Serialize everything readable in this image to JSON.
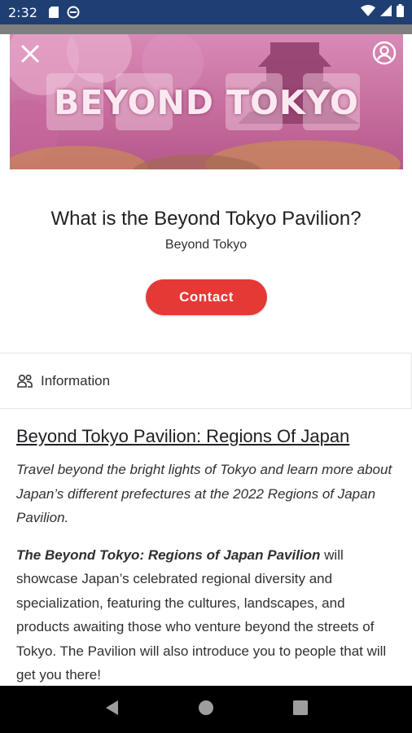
{
  "status_bar": {
    "time": "2:32",
    "icons": [
      "sd-card-icon",
      "do-not-disturb-icon",
      "wifi-icon",
      "signal-icon",
      "battery-icon"
    ]
  },
  "header": {
    "banner_text": "BEYOND TOKYO",
    "close_icon": "close-icon",
    "profile_icon": "account-circle-icon"
  },
  "event": {
    "title": "What is the Beyond Tokyo Pavilion?",
    "organizer": "Beyond Tokyo",
    "contact_label": "Contact"
  },
  "info_tab": {
    "icon": "people-icon",
    "label": "Information"
  },
  "content": {
    "heading": "Beyond Tokyo Pavilion: Regions Of Japan",
    "intro": "Travel beyond the bright lights of Tokyo and learn more about Japan’s different prefectures at the 2022 Regions of Japan Pavilion.",
    "body_bold": "The Beyond Tokyo: Regions of Japan Pavilion",
    "body_rest": " will showcase Japan’s celebrated regional diversity and specialization, featuring the cultures, landscapes, and products awaiting those who venture beyond the streets of Tokyo. The Pavilion will also introduce you to people that will get you there!"
  },
  "nav_bar": {
    "back": "back-icon",
    "home": "home-icon",
    "recents": "recents-icon"
  },
  "colors": {
    "status_bar": "#1f3f73",
    "accent": "#e53935",
    "banner_tint": "#c56f9d"
  }
}
